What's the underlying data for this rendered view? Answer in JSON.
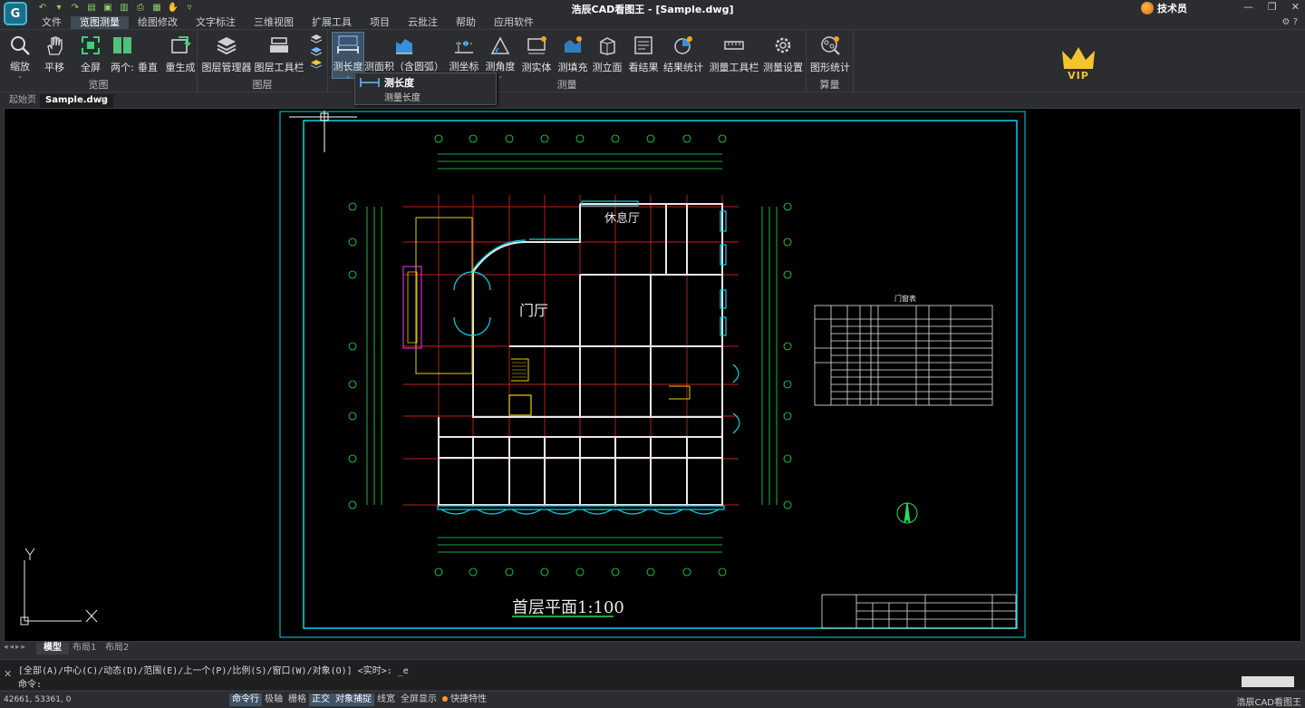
{
  "window": {
    "title": "浩辰CAD看图王 - [Sample.dwg]",
    "user_name": "技术员",
    "app_logo": "app-logo-icon"
  },
  "menu": {
    "tabs": [
      "文件",
      "览图测量",
      "绘图修改",
      "文字标注",
      "三维视图",
      "扩展工具",
      "项目",
      "云批注",
      "帮助",
      "应用软件"
    ],
    "active_index": 1
  },
  "ribbon": {
    "groups": {
      "browse": {
        "label": "览图",
        "tools": [
          "缩放",
          "平移",
          "全屏",
          "两个:",
          "垂直",
          "重生成"
        ]
      },
      "layers": {
        "label": "图层",
        "tools": [
          "图层管理器",
          "图层工具栏"
        ]
      },
      "measure": {
        "label": "测量",
        "tools": [
          "测长度",
          "测面积（含圆弧）",
          "测坐标",
          "测角度",
          "测实体",
          "测填充",
          "测立面",
          "看结果",
          "结果统计",
          "测量工具栏",
          "测量设置"
        ]
      },
      "calc": {
        "label": "算量",
        "tools": [
          "图形统计"
        ]
      }
    },
    "vip_label": "VIP"
  },
  "tooltip": {
    "title": "测长度",
    "description": "测量长度"
  },
  "doc_tabs": [
    {
      "label": "起始页"
    },
    {
      "label": "Sample.dwg"
    }
  ],
  "drawing": {
    "hall_label": "门厅",
    "lounge_label": "休息厅",
    "plan_title": "首层平面",
    "scale": "1:100",
    "table_title": "门窗表",
    "ucs_x": "X",
    "ucs_y": "Y"
  },
  "layout_tabs": [
    "模型",
    "布局1",
    "布局2"
  ],
  "command": {
    "history": "[全部(A)/中心(C)/动态(D)/范围(E)/上一个(P)/比例(S)/窗口(W)/对象(O)] <实时>: _e",
    "prompt": "命令:"
  },
  "status": {
    "coords": "42661, 53361, 0",
    "items": [
      "命令行",
      "极轴",
      "栅格",
      "正交",
      "对象捕捉",
      "线宽",
      "全屏显示",
      "快捷特性"
    ],
    "brand": "浩辰CAD看图王"
  },
  "colors": {
    "accent": "#3f5266",
    "canvas": "#000000",
    "cad_cyan": "#00d7e6",
    "cad_green": "#22e05a",
    "cad_red": "#ff2a2a",
    "vip_gold": "#f4c430"
  }
}
